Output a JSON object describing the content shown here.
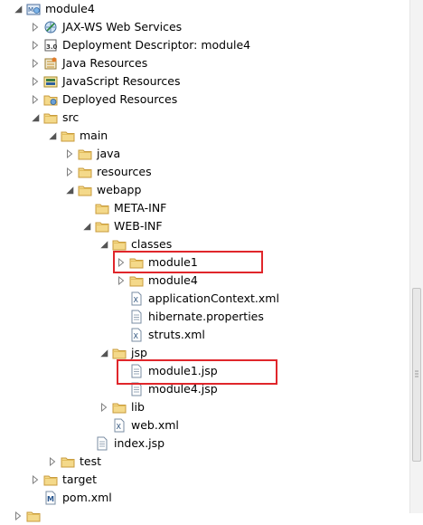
{
  "tree": {
    "items": [
      {
        "label": "module4",
        "icon": "web-project-icon",
        "indent": 0,
        "toggle": "expanded",
        "name": "module4"
      },
      {
        "label": "JAX-WS Web Services",
        "icon": "web-services-icon",
        "indent": 1,
        "toggle": "collapsed",
        "name": "jax-ws-web-services"
      },
      {
        "label": "Deployment Descriptor: module4",
        "icon": "deployment-descriptor-icon",
        "indent": 1,
        "toggle": "collapsed",
        "name": "deployment-descriptor"
      },
      {
        "label": "Java Resources",
        "icon": "java-resources-icon",
        "indent": 1,
        "toggle": "collapsed",
        "name": "java-resources"
      },
      {
        "label": "JavaScript Resources",
        "icon": "javascript-resources-icon",
        "indent": 1,
        "toggle": "collapsed",
        "name": "javascript-resources"
      },
      {
        "label": "Deployed Resources",
        "icon": "deployed-resources-icon",
        "indent": 1,
        "toggle": "collapsed",
        "name": "deployed-resources"
      },
      {
        "label": "src",
        "icon": "folder-icon",
        "indent": 1,
        "toggle": "expanded",
        "name": "src"
      },
      {
        "label": "main",
        "icon": "folder-icon",
        "indent": 2,
        "toggle": "expanded",
        "name": "main"
      },
      {
        "label": "java",
        "icon": "folder-icon",
        "indent": 3,
        "toggle": "collapsed",
        "name": "java"
      },
      {
        "label": "resources",
        "icon": "folder-icon",
        "indent": 3,
        "toggle": "collapsed",
        "name": "resources"
      },
      {
        "label": "webapp",
        "icon": "folder-icon",
        "indent": 3,
        "toggle": "expanded",
        "name": "webapp"
      },
      {
        "label": "META-INF",
        "icon": "folder-icon",
        "indent": 4,
        "toggle": "none",
        "name": "meta-inf"
      },
      {
        "label": "WEB-INF",
        "icon": "folder-icon",
        "indent": 4,
        "toggle": "expanded",
        "name": "web-inf"
      },
      {
        "label": "classes",
        "icon": "folder-icon",
        "indent": 5,
        "toggle": "expanded",
        "name": "classes"
      },
      {
        "label": "module1",
        "icon": "folder-icon",
        "indent": 6,
        "toggle": "collapsed",
        "name": "classes-module1"
      },
      {
        "label": "module4",
        "icon": "folder-icon",
        "indent": 6,
        "toggle": "collapsed",
        "name": "classes-module4"
      },
      {
        "label": "applicationContext.xml",
        "icon": "xml-file-icon",
        "indent": 6,
        "toggle": "none",
        "name": "applicationcontext-xml"
      },
      {
        "label": "hibernate.properties",
        "icon": "text-file-icon",
        "indent": 6,
        "toggle": "none",
        "name": "hibernate-properties"
      },
      {
        "label": "struts.xml",
        "icon": "xml-file-icon",
        "indent": 6,
        "toggle": "none",
        "name": "struts-xml"
      },
      {
        "label": "jsp",
        "icon": "folder-icon",
        "indent": 5,
        "toggle": "expanded",
        "name": "jsp"
      },
      {
        "label": "module1.jsp",
        "icon": "text-file-icon",
        "indent": 6,
        "toggle": "none",
        "name": "module1-jsp"
      },
      {
        "label": "module4.jsp",
        "icon": "text-file-icon",
        "indent": 6,
        "toggle": "none",
        "name": "module4-jsp"
      },
      {
        "label": "lib",
        "icon": "folder-icon",
        "indent": 5,
        "toggle": "collapsed",
        "name": "lib"
      },
      {
        "label": "web.xml",
        "icon": "xml-file-icon",
        "indent": 5,
        "toggle": "none",
        "name": "web-xml"
      },
      {
        "label": "index.jsp",
        "icon": "text-file-icon",
        "indent": 4,
        "toggle": "none",
        "name": "index-jsp"
      },
      {
        "label": "test",
        "icon": "folder-icon",
        "indent": 2,
        "toggle": "collapsed",
        "name": "test"
      },
      {
        "label": "target",
        "icon": "folder-icon",
        "indent": 1,
        "toggle": "collapsed",
        "name": "target"
      },
      {
        "label": "pom.xml",
        "icon": "maven-pom-icon",
        "indent": 1,
        "toggle": "none",
        "name": "pom-xml"
      }
    ]
  },
  "highlights": [
    {
      "target_index": 14,
      "color": "#e0262b"
    },
    {
      "target_index": 20,
      "color": "#e0262b"
    }
  ],
  "colors": {
    "highlight_border": "#e0262b",
    "folder_fill": "#f4d98a",
    "folder_stroke": "#c89b3c"
  }
}
